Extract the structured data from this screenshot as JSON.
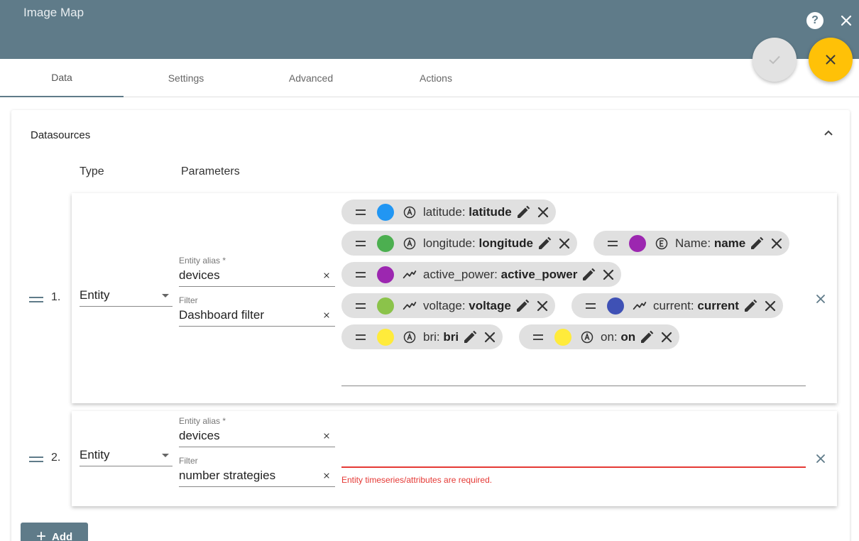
{
  "header": {
    "title": "Image Map"
  },
  "tabs": [
    {
      "label": "Data",
      "active": true
    },
    {
      "label": "Settings",
      "active": false
    },
    {
      "label": "Advanced",
      "active": false
    },
    {
      "label": "Actions",
      "active": false
    }
  ],
  "datasources": {
    "title": "Datasources",
    "col_type": "Type",
    "col_params": "Parameters",
    "rows": [
      {
        "index": "1.",
        "type": "Entity",
        "alias_label": "Entity alias *",
        "alias_value": "devices",
        "filter_label": "Filter",
        "filter_value": "Dashboard filter",
        "keys": [
          {
            "label": "latitude:",
            "name": "latitude",
            "color": "#2196f3",
            "kind": "attribute"
          },
          {
            "label": "longitude:",
            "name": "longitude",
            "color": "#4caf50",
            "kind": "attribute"
          },
          {
            "label": "Name:",
            "name": "name",
            "color": "#9c27b0",
            "kind": "entity-field"
          },
          {
            "label": "active_power:",
            "name": "active_power",
            "color": "#9c27b0",
            "kind": "timeseries"
          },
          {
            "label": "voltage:",
            "name": "voltage",
            "color": "#8bc34a",
            "kind": "timeseries"
          },
          {
            "label": "current:",
            "name": "current",
            "color": "#3f51b5",
            "kind": "timeseries"
          },
          {
            "label": "bri:",
            "name": "bri",
            "color": "#ffeb3b",
            "kind": "attribute"
          },
          {
            "label": "on:",
            "name": "on",
            "color": "#ffeb3b",
            "kind": "attribute"
          }
        ]
      },
      {
        "index": "2.",
        "type": "Entity",
        "alias_label": "Entity alias *",
        "alias_value": "devices",
        "filter_label": "Filter",
        "filter_value": "number strategies",
        "error": "Entity timeseries/attributes are required."
      }
    ],
    "add_label": "Add"
  },
  "colors": {
    "header": "#5f7b89",
    "accent": "#ffc107",
    "error": "#e53935"
  }
}
